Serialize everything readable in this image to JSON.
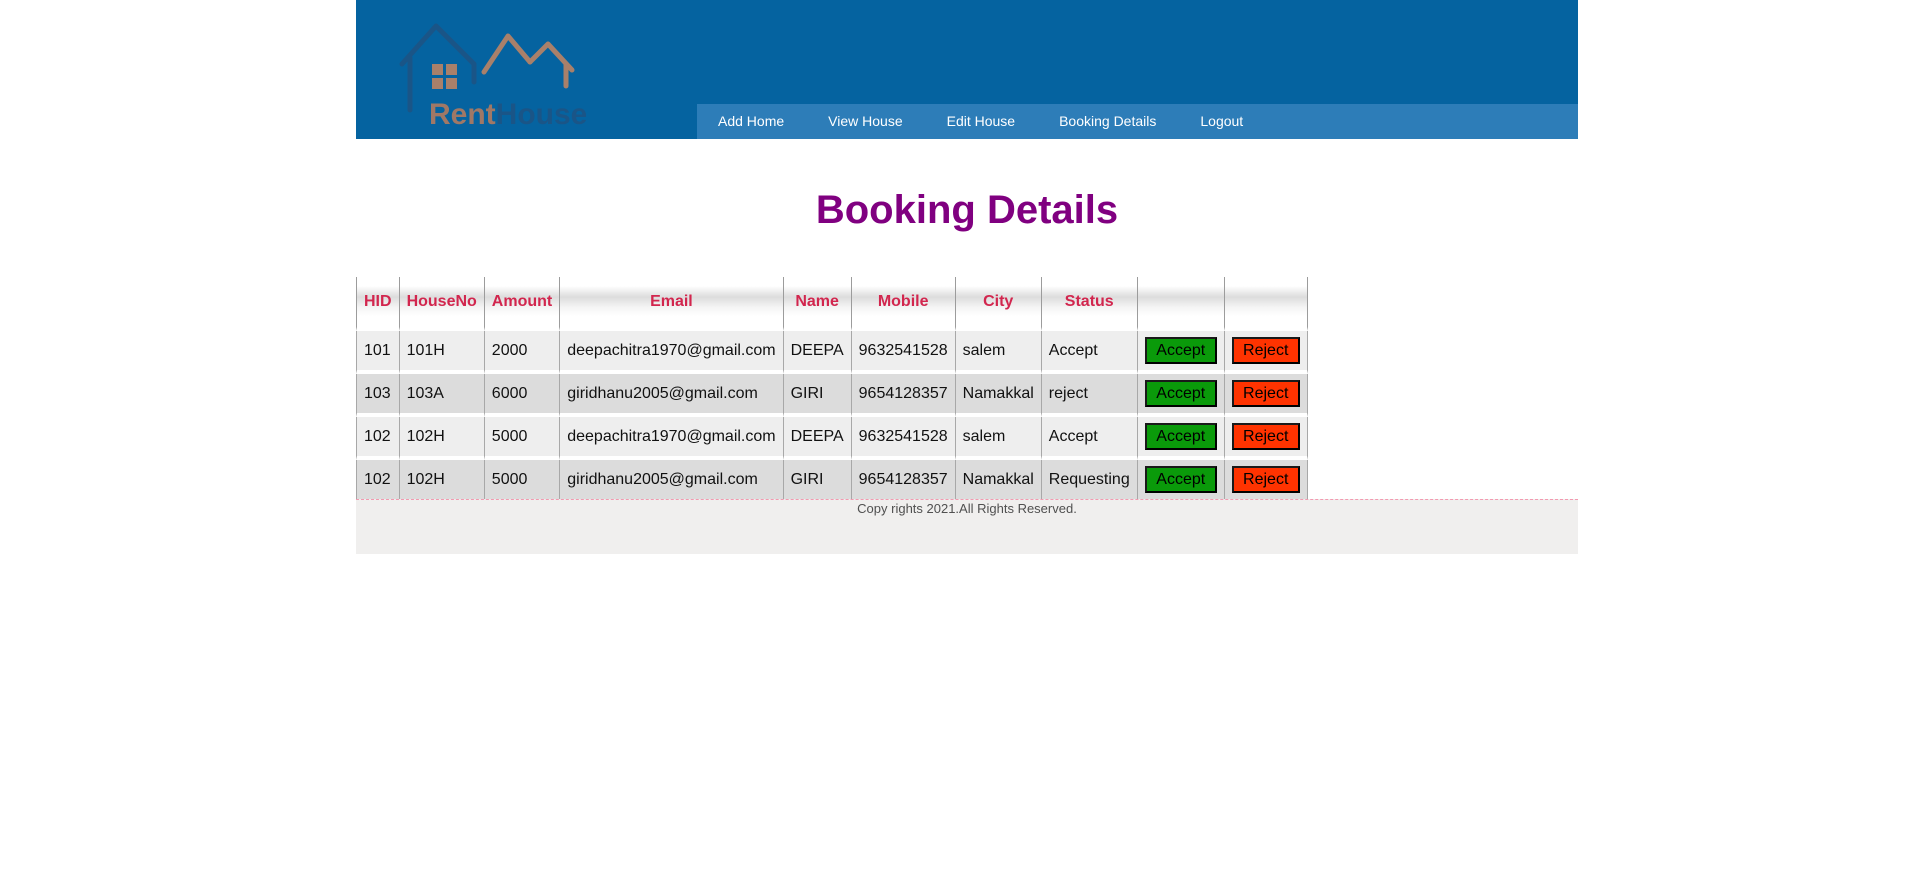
{
  "brand": {
    "logo_text_rent": "Rent",
    "logo_text_house": "House",
    "colors": {
      "header": "#0563a0",
      "nav": "#2d7db8",
      "logo_house": "#1a5587",
      "logo_roof": "#a9806a",
      "logo_text_rent": "#a07866",
      "logo_text_house": "#1a5587"
    }
  },
  "nav": {
    "items": [
      {
        "label": "Add Home"
      },
      {
        "label": "View House"
      },
      {
        "label": "Edit House"
      },
      {
        "label": "Booking Details"
      },
      {
        "label": "Logout"
      }
    ]
  },
  "page": {
    "title": "Booking Details",
    "title_color": "#800080"
  },
  "table": {
    "headers": [
      "HID",
      "HouseNo",
      "Amount",
      "Email",
      "Name",
      "Mobile",
      "City",
      "Status",
      "",
      ""
    ],
    "header_color": "#d2264e",
    "accept_label": "Accept",
    "reject_label": "Reject",
    "rows": [
      {
        "hid": "101",
        "houseno": "101H",
        "amount": "2000",
        "email": "deepachitra1970@gmail.com",
        "name": "DEEPA",
        "mobile": "9632541528",
        "city": "salem",
        "status": "Accept"
      },
      {
        "hid": "103",
        "houseno": "103A",
        "amount": "6000",
        "email": "giridhanu2005@gmail.com",
        "name": "GIRI",
        "mobile": "9654128357",
        "city": "Namakkal",
        "status": "reject"
      },
      {
        "hid": "102",
        "houseno": "102H",
        "amount": "5000",
        "email": "deepachitra1970@gmail.com",
        "name": "DEEPA",
        "mobile": "9632541528",
        "city": "salem",
        "status": "Accept"
      },
      {
        "hid": "102",
        "houseno": "102H",
        "amount": "5000",
        "email": "giridhanu2005@gmail.com",
        "name": "GIRI",
        "mobile": "9654128357",
        "city": "Namakkal",
        "status": "Requesting"
      }
    ]
  },
  "footer": {
    "text": "Copy rights 2021.All Rights Reserved."
  }
}
